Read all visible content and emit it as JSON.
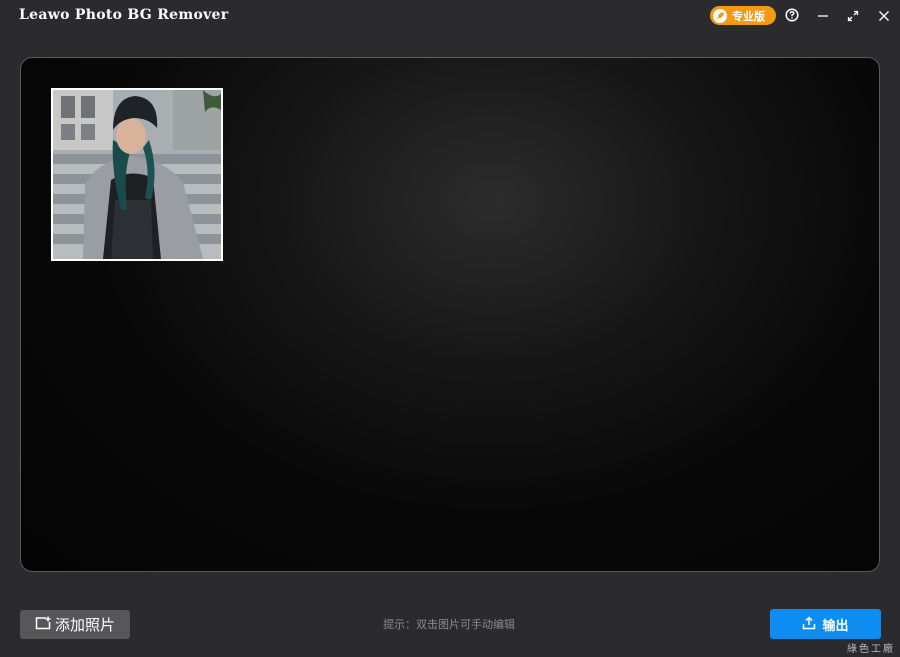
{
  "window": {
    "title": "Leawo Photo BG Remover",
    "pro_badge_label": "专业版",
    "help_icon": "help-circle-icon",
    "minimize_icon": "minimize-icon",
    "maximize_icon": "maximize-icon",
    "close_icon": "close-icon"
  },
  "workspace": {
    "photos": [
      {
        "description_icon": "photo-thumbnail"
      }
    ]
  },
  "footer": {
    "add_button_label": "添加照片",
    "hint": "提示：双击图片可手动编辑",
    "export_button_label": "输出",
    "watermark": "綠色工廠"
  },
  "colors": {
    "accent_blue": "#0d8df2",
    "pro_orange": "#f29a16",
    "background": "#2b2b2e"
  }
}
